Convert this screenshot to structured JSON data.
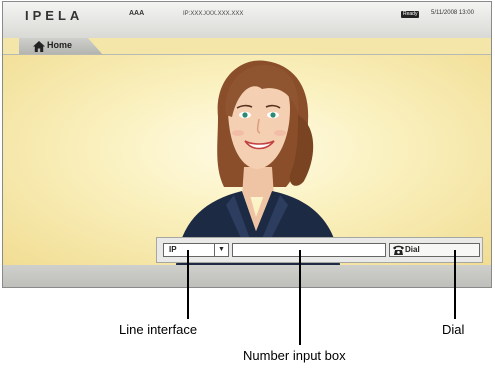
{
  "header": {
    "logo": "IPELA",
    "user": "AAA",
    "ip_address": "IP:XXX.XXX.XXX.XXX",
    "status_badge": "Ready",
    "datetime": "5/11/2008 13:00"
  },
  "tab": {
    "label": "Home",
    "icon": "home-icon"
  },
  "controls": {
    "line_interface_value": "IP",
    "line_interface_arrow": "▼",
    "number_input_value": "",
    "dial_label": "Dial",
    "dial_icon": "phone-icon"
  },
  "callouts": {
    "line_interface": "Line interface",
    "number_input": "Number input box",
    "dial": "Dial"
  },
  "colors": {
    "video_background": "#f6e8a8",
    "topbar": "#e4e4e1",
    "bottombar": "#c7c7c3"
  }
}
